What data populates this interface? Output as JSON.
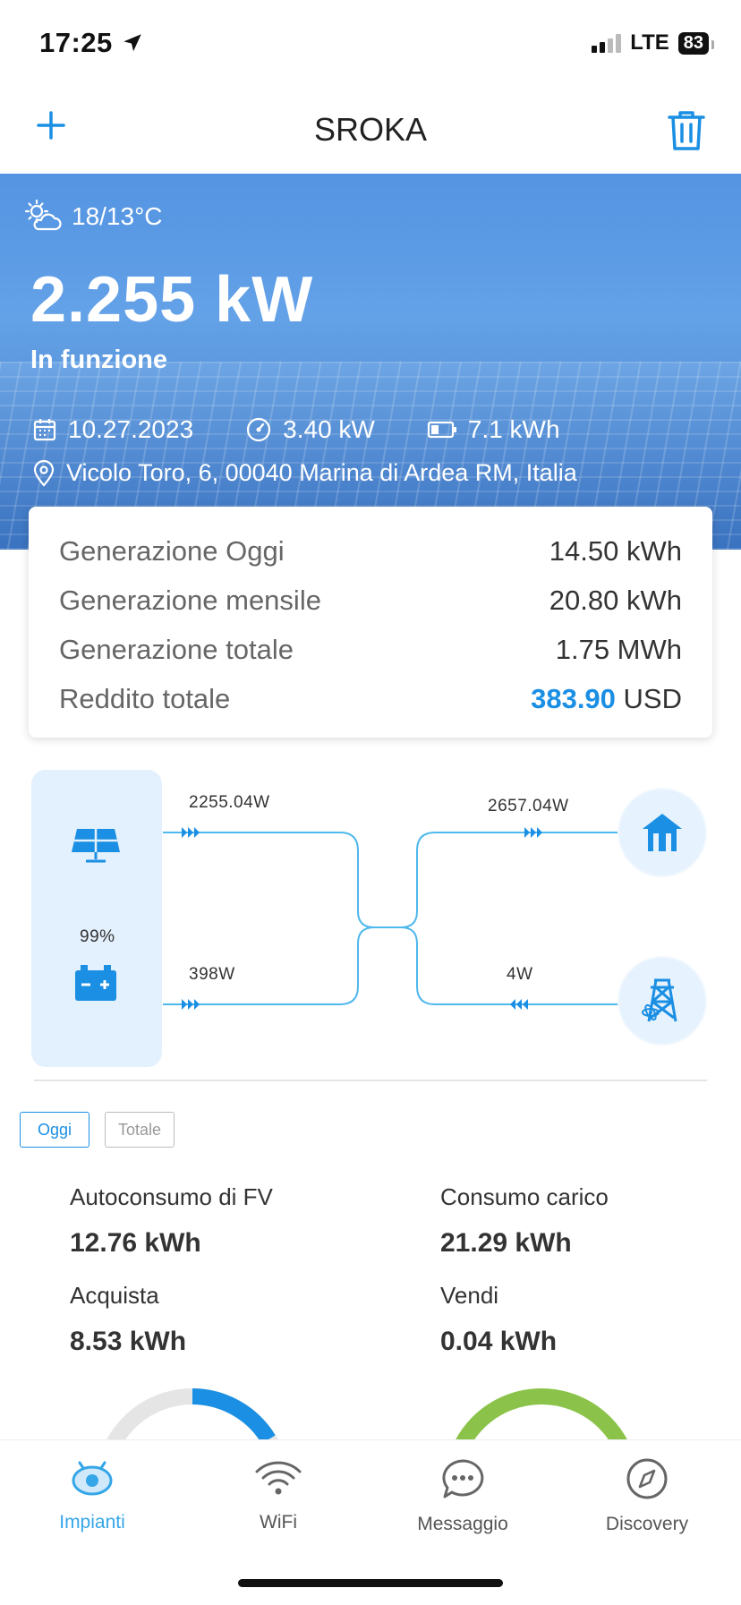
{
  "status_bar": {
    "time": "17:25",
    "network": "LTE",
    "battery": "83"
  },
  "nav": {
    "title": "SROKA",
    "add_icon": "plus-icon",
    "delete_icon": "trash-icon"
  },
  "hero": {
    "weather": "18/13°C",
    "power": "2.255 kW",
    "status": "In funzione",
    "date": "10.27.2023",
    "capacity": "3.40 kW",
    "battery_capacity": "7.1 kWh",
    "address": "Vicolo Toro, 6, 00040 Marina di Ardea RM, Italia"
  },
  "summary": {
    "rows": [
      {
        "label": "Generazione Oggi",
        "value": "14.50 kWh"
      },
      {
        "label": "Generazione mensile",
        "value": "20.80 kWh"
      },
      {
        "label": "Generazione totale",
        "value": "1.75 MWh"
      }
    ],
    "income_label": "Reddito totale",
    "income_value": "383.90",
    "income_currency": "USD"
  },
  "flow": {
    "pv_power": "2255.04W",
    "battery_power": "398W",
    "battery_soc": "99%",
    "load_power": "2657.04W",
    "grid_power": "4W"
  },
  "tabs": {
    "today": "Oggi",
    "total": "Totale"
  },
  "stats": {
    "self_consumption_label": "Autoconsumo di FV",
    "self_consumption_value": "12.76 kWh",
    "load_label": "Consumo carico",
    "load_value": "21.29 kWh",
    "buy_label": "Acquista",
    "buy_value": "8.53 kWh",
    "sell_label": "Vendi",
    "sell_value": "0.04 kWh"
  },
  "tabbar": {
    "items": [
      {
        "label": "Impianti",
        "icon": "plant-icon",
        "active": true
      },
      {
        "label": "WiFi",
        "icon": "wifi-icon",
        "active": false
      },
      {
        "label": "Messaggio",
        "icon": "message-icon",
        "active": false
      },
      {
        "label": "Discovery",
        "icon": "compass-icon",
        "active": false
      }
    ]
  },
  "colors": {
    "accent": "#1a8fe3",
    "flow_line": "#4fb8ec",
    "gauge_green": "#8bc34a",
    "gauge_blue": "#1a8fe3"
  }
}
